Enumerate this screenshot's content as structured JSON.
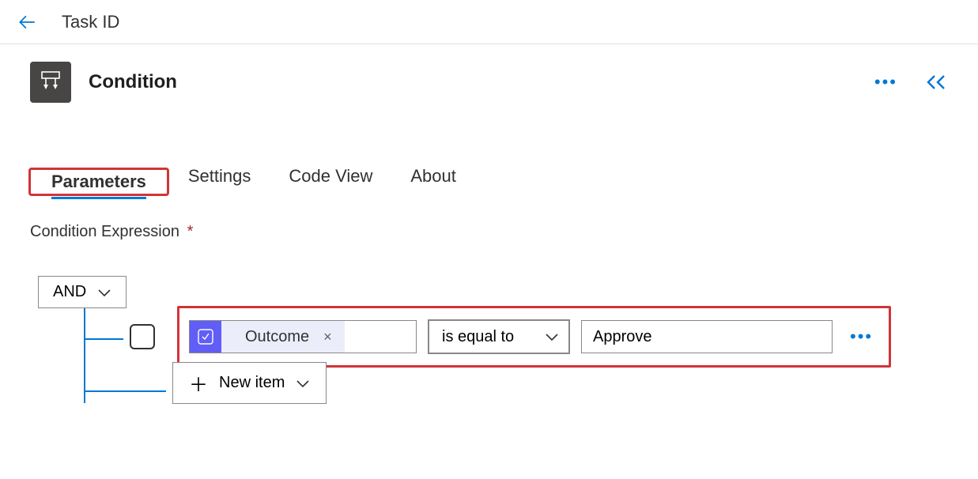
{
  "header": {
    "title": "Task ID"
  },
  "card": {
    "title": "Condition",
    "icon": "condition-icon"
  },
  "tabs": {
    "items": [
      {
        "label": "Parameters",
        "active": true
      },
      {
        "label": "Settings",
        "active": false
      },
      {
        "label": "Code View",
        "active": false
      },
      {
        "label": "About",
        "active": false
      }
    ]
  },
  "section": {
    "label": "Condition Expression",
    "required": "*"
  },
  "condition": {
    "group_operator": "AND",
    "rows": [
      {
        "left_token": "Outcome",
        "left_token_icon": "dynamic-content-icon",
        "operator": "is equal to",
        "right_value": "Approve"
      }
    ],
    "new_item_label": "New item"
  },
  "colors": {
    "accent": "#0078d4",
    "highlight": "#d13438",
    "token_bg": "#605ef7"
  }
}
